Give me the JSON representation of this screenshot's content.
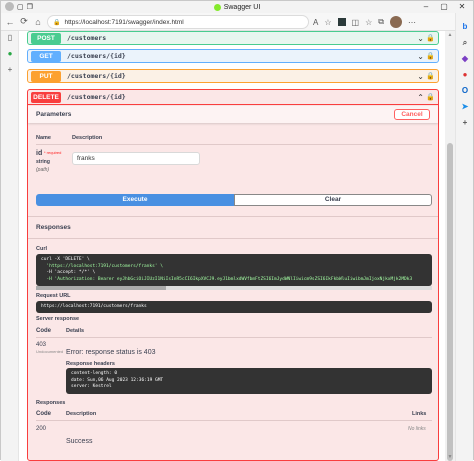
{
  "window": {
    "title": "Swagger UI",
    "url": "https://localhost:7191/swagger/index.html"
  },
  "operations": [
    {
      "method": "POST",
      "path": "/customers"
    },
    {
      "method": "GET",
      "path": "/customers/{id}"
    },
    {
      "method": "PUT",
      "path": "/customers/{id}"
    }
  ],
  "delete_op": {
    "method": "DELETE",
    "path": "/customers/{id}",
    "parameters_label": "Parameters",
    "cancel_label": "Cancel",
    "col_name": "Name",
    "col_description": "Description",
    "param": {
      "name": "id",
      "required": "* required",
      "type": "string",
      "in": "(path)",
      "value": "franks"
    },
    "execute_label": "Execute",
    "clear_label": "Clear"
  },
  "responses_section": {
    "title": "Responses",
    "curl_label": "Curl",
    "curl_line1": "curl -X 'DELETE' \\",
    "curl_line2": "  'https://localhost:7191/customers/franks' \\",
    "curl_line3": "  -H 'accept: */*' \\",
    "curl_line4": "  -H 'Authorization: Bearer eyJhbGciOiJIUzI1NiIsInR5cCI6IkpXVCJ9.eyJ1bmlxdWVfbmFtZSI6ImJydWNlIiwicm9sZSI6IkFkbWluIiwibmJmIjoxNjkxMjk2MDk3",
    "request_url_label": "Request URL",
    "request_url": "https://localhost:7191/customers/franks",
    "server_response_label": "Server response",
    "code_col": "Code",
    "details_col": "Details",
    "code": "403",
    "undocumented": "Undocumented",
    "error_text": "Error: response status is 403",
    "response_headers_label": "Response headers",
    "header_line1": "content-length: 0",
    "header_line2": "date: Sun,06 Aug 2023 12:36:19 GMT",
    "header_line3": "server: Kestrel"
  },
  "documented_responses": {
    "title": "Responses",
    "code_col": "Code",
    "description_col": "Description",
    "links_col": "Links",
    "code": "200",
    "description": "Success",
    "links": "No links"
  }
}
